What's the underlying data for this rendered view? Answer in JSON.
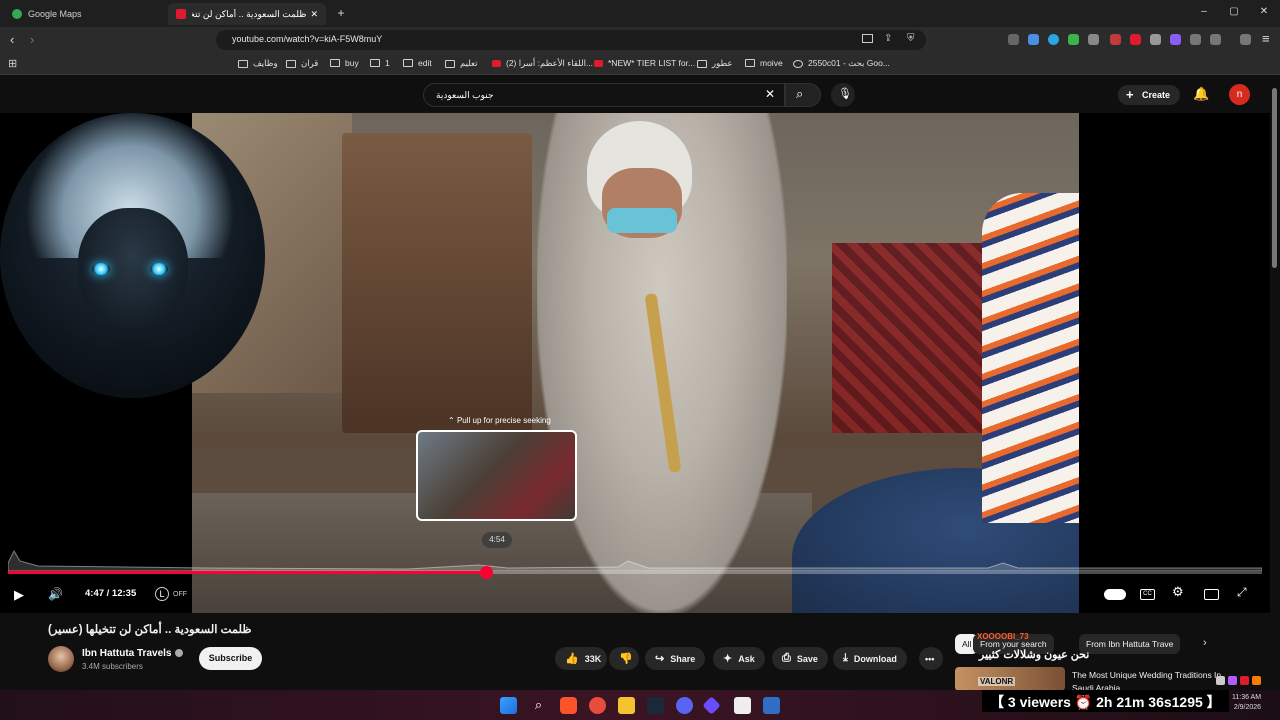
{
  "browser": {
    "tabs": [
      {
        "label": "Google Maps",
        "active": false
      },
      {
        "label": "ظلمت السعودية .. أماكن لن تتخيلها (",
        "active": true
      }
    ],
    "new_tab": "+",
    "url": "youtube.com/watch?v=kiA-F5W8muY",
    "bookmarks": [
      "وظايف",
      "قران",
      "buy",
      "1",
      "edit",
      "تعليم",
      "(2) اللقاء الأعظم: أسرا...",
      "*NEW* TIER LIST for...",
      "عطور",
      "moive",
      "2550c01 - بحث Goo..."
    ]
  },
  "youtube": {
    "search_query": "جنوب السعودية",
    "create_label": "Create",
    "avatar_letter": "n",
    "player": {
      "pull_up_hint": "Pull up for precise seeking",
      "preview_time": "4:54",
      "time_display": "4:47 / 12:35",
      "progress_fraction": 0.381,
      "autoplay_off": "OFF"
    },
    "video": {
      "title": "ظلمت السعودية .. أماكن لن تتخيلها (عسير)",
      "channel": "Ibn Hattuta Travels",
      "subscribers": "3.4M subscribers",
      "subscribe_label": "Subscribe",
      "likes": "33K",
      "share_label": "Share",
      "ask_label": "Ask",
      "save_label": "Save",
      "download_label": "Download"
    },
    "chips": [
      "All",
      "From your search",
      "From Ibn Hattuta Trave"
    ],
    "related": {
      "title": "The Most Unique Wedding Traditions In Saudi Arabia ..."
    }
  },
  "stream_overlay": {
    "chat": [
      {
        "user": "XOOOOBI_73",
        "message": "نحن عيون وشلالات كثيير"
      },
      {
        "user": "VALONR",
        "message": ""
      }
    ],
    "viewers_text": "【 3 viewers ⏰ 2h 21m 36s1295 】"
  },
  "taskbar": {
    "time": "11:36 AM",
    "date": "2/9/2026"
  },
  "colors": {
    "accent_red": "#ff0033",
    "avatar_red": "#d92a20"
  }
}
